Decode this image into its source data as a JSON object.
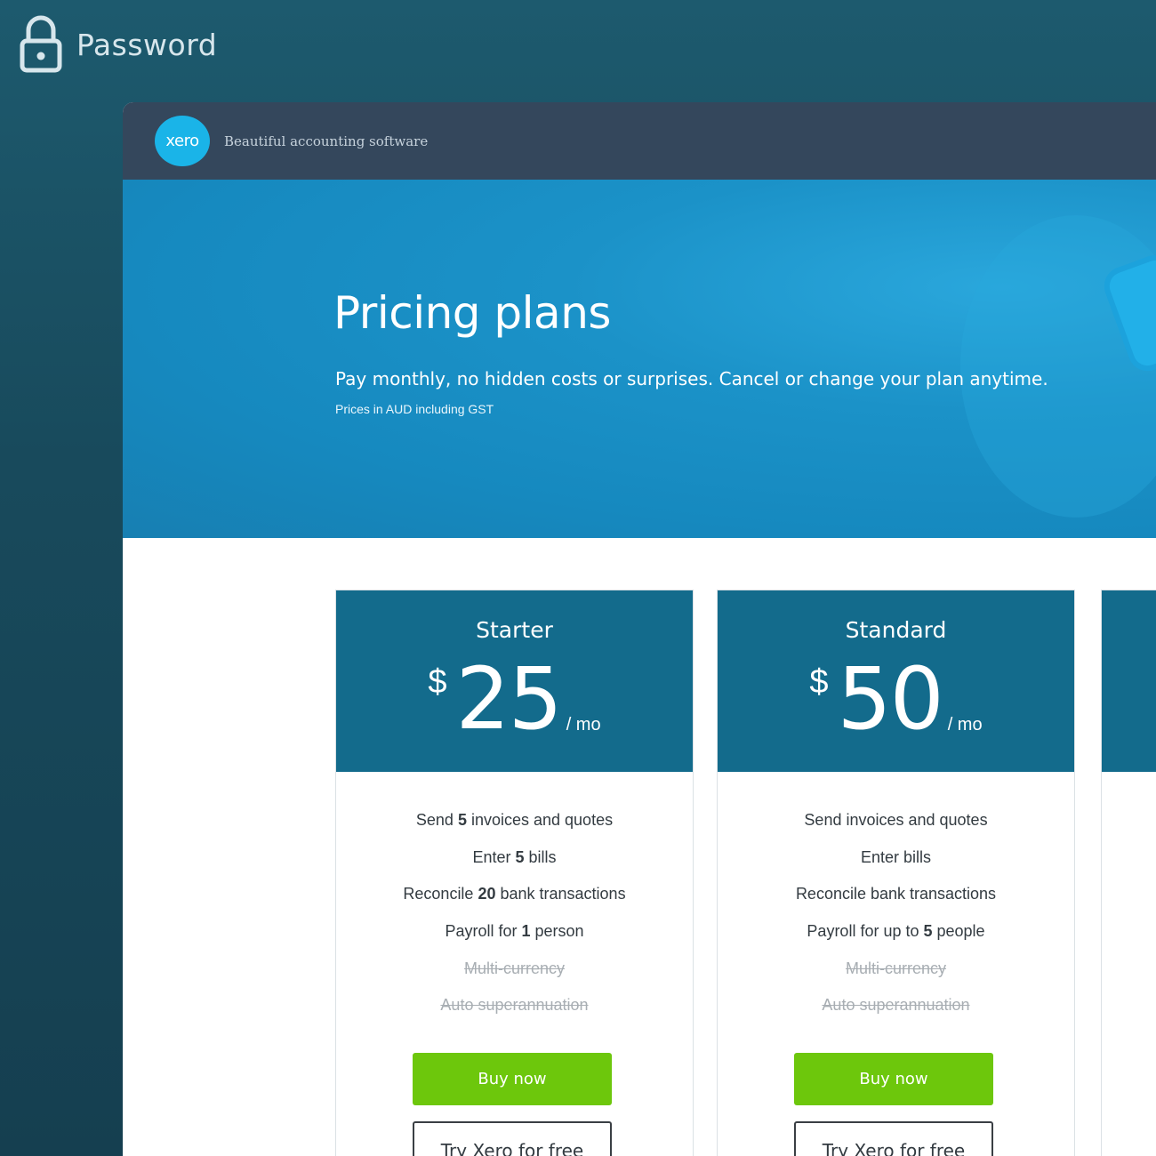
{
  "overlay": {
    "label": "Password",
    "icon": "lock-icon"
  },
  "header": {
    "logo_text": "xero",
    "tagline": "Beautiful accounting software"
  },
  "hero": {
    "title": "Pricing plans",
    "subtitle": "Pay monthly, no hidden costs or surprises. Cancel or change your plan anytime.",
    "note": "Prices in AUD including GST"
  },
  "plans": [
    {
      "name": "Starter",
      "currency": "$",
      "price": "25",
      "period": "/ mo",
      "features": [
        {
          "pre": "Send ",
          "num": "5",
          "post": " invoices and quotes"
        },
        {
          "pre": "Enter ",
          "num": "5",
          "post": " bills"
        },
        {
          "pre": "Reconcile ",
          "num": "20",
          "post": " bank transactions"
        },
        {
          "pre": "Payroll for ",
          "num": "1",
          "post": " person"
        }
      ],
      "excluded": [
        "Multi-currency",
        "Auto superannuation"
      ],
      "buy_label": "Buy now",
      "try_label": "Try Xero for free"
    },
    {
      "name": "Standard",
      "currency": "$",
      "price": "50",
      "period": "/ mo",
      "features": [
        {
          "pre": "Send invoices and quotes",
          "num": "",
          "post": ""
        },
        {
          "pre": "Enter bills",
          "num": "",
          "post": ""
        },
        {
          "pre": "Reconcile bank transactions",
          "num": "",
          "post": ""
        },
        {
          "pre": "Payroll for up to ",
          "num": "5",
          "post": " people"
        }
      ],
      "excluded": [
        "Multi-currency",
        "Auto superannuation"
      ],
      "buy_label": "Buy now",
      "try_label": "Try Xero for free"
    }
  ],
  "colors": {
    "background": "#184a5c",
    "header": "#34475c",
    "hero": "#1689bf",
    "card_head": "#136b8c",
    "buy_button": "#6dc70c",
    "logo": "#1ab4e8"
  }
}
